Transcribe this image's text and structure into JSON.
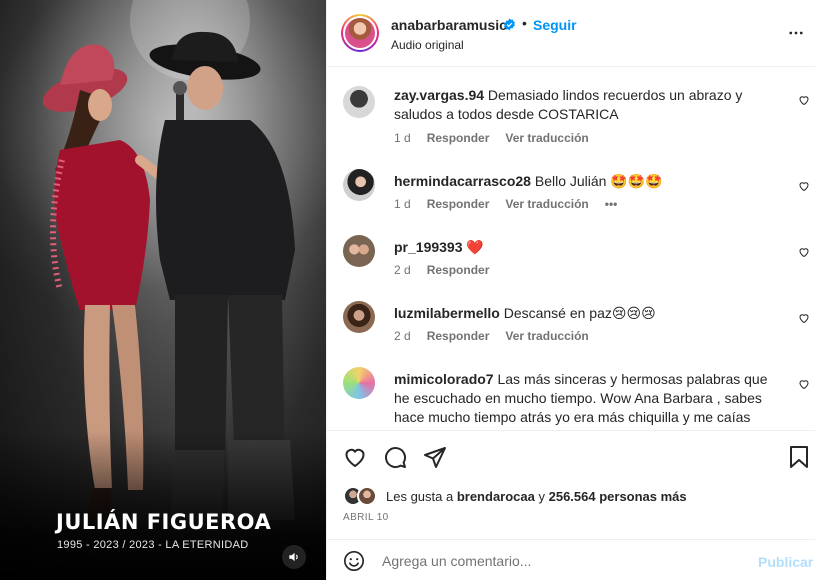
{
  "media": {
    "caption_title": "JULIÁN FIGUEROA",
    "caption_sub": "1995 - 2023  /  2023 - LA ETERNIDAD",
    "sound_icon": "speaker-icon"
  },
  "header": {
    "username": "anabarbaramusic",
    "follow_label": "Seguir",
    "separator": "•",
    "audio_label": "Audio original",
    "more_icon": "more-horizontal-icon"
  },
  "comments": [
    {
      "user": "zay.vargas.94",
      "text": "Demasiado lindos recuerdos un abrazo y saludos a todos desde COSTARICA",
      "time": "1 d",
      "reply": "Responder",
      "translate": "Ver traducción"
    },
    {
      "user": "hermindacarrasco28",
      "text": "Bello Julián 🤩🤩🤩",
      "time": "1 d",
      "reply": "Responder",
      "translate": "Ver traducción",
      "options": "•••"
    },
    {
      "user": "pr_199393",
      "text": "❤️",
      "time": "2 d",
      "reply": "Responder"
    },
    {
      "user": "luzmilabermello",
      "text": "Descansé en paz😢😢😢",
      "time": "2 d",
      "reply": "Responder",
      "translate": "Ver traducción"
    },
    {
      "user": "mimicolorado7",
      "text": "Las más sinceras y hermosas palabras que he escuchado en mucho tiempo. Wow Ana Barbara , sabes hace mucho tiempo atrás yo era más chiquilla y me caías súper mal."
    }
  ],
  "likes": {
    "prefix": "Les gusta a ",
    "user": "brendarocaa",
    "middle": " y ",
    "count": "256.564 personas más"
  },
  "date": "ABRIL 10",
  "composer": {
    "placeholder": "Agrega un comentario...",
    "publish_label": "Publicar"
  },
  "colors": {
    "accent": "#0095f6",
    "publish_disabled": "#b2dffc",
    "verified": "#0095f6"
  }
}
